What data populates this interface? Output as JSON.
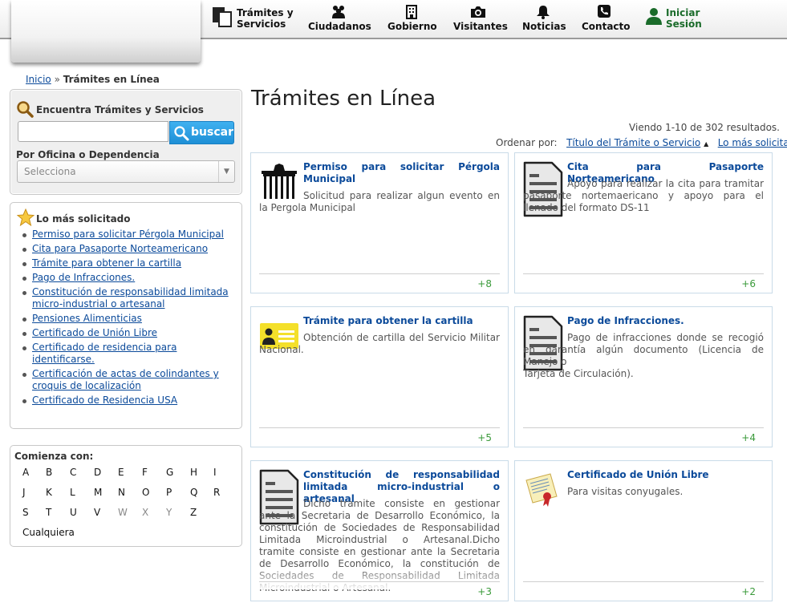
{
  "nav": {
    "items": [
      {
        "label_1": "Trámites y",
        "label_2": "Servicios"
      },
      {
        "label": "Ciudadanos"
      },
      {
        "label": "Gobierno"
      },
      {
        "label": "Visitantes"
      },
      {
        "label": "Noticias"
      },
      {
        "label": "Contacto"
      },
      {
        "label_1": "Iniciar",
        "label_2": "Sesión"
      }
    ]
  },
  "breadcrumb": {
    "home": "Inicio",
    "sep": "»",
    "current": "Trámites en Línea"
  },
  "search": {
    "title": "Encuentra Trámites y Servicios",
    "input_value": "",
    "button": "buscar",
    "office_label": "Por Oficina o Dependencia",
    "office_selected": "Selecciona"
  },
  "popular": {
    "title": "Lo más solicitado",
    "items": [
      "Permiso para solicitar Pérgola Municipal",
      "Cita para Pasaporte Norteamericano",
      "Trámite para obtener la cartilla",
      "Pago de Infracciones.",
      "Constitución de responsabilidad limitada micro-industrial o artesanal",
      "Pensiones Alimenticias",
      "Certificado de Unión Libre",
      "Certificado de residencia para identificarse.",
      "Certificación de actas de colindantes y croquis de localización",
      "Certificado de Residencia USA"
    ]
  },
  "alpha": {
    "title": "Comienza con:",
    "letters": [
      "A",
      "B",
      "C",
      "D",
      "E",
      "F",
      "G",
      "H",
      "I",
      "J",
      "K",
      "L",
      "M",
      "N",
      "O",
      "P",
      "Q",
      "R",
      "S",
      "T",
      "U",
      "V",
      "W",
      "X",
      "Y",
      "Z"
    ],
    "disabled": [
      "W",
      "X",
      "Y"
    ],
    "any": "Cualquiera"
  },
  "main": {
    "title": "Trámites en Línea",
    "results": "Viendo 1-10 de 302 resultados.",
    "order_label": "Ordenar por:",
    "order_title": "Título del Trámite o Servicio",
    "order_popular": "Lo más solicitado"
  },
  "cards": [
    {
      "icon": "pergola-gate-icon",
      "title": "Permiso para solicitar Pérgola Municipal",
      "desc": "Solicitud para realizar algun evento en la Pergola Municipal",
      "count": "+8"
    },
    {
      "icon": "document-icon",
      "title": "Cita para Pasaporte Norteamericano",
      "desc": "Apoyo para realizar la cita para tramitar pasaporte nortemaericano y apoyo para el llenado del formato DS-11",
      "count": "+6"
    },
    {
      "icon": "id-card-icon",
      "title": "Trámite para obtener la cartilla",
      "desc": "Obtención de cartilla del Servicio Militar Nacional.",
      "count": "+5"
    },
    {
      "icon": "document-icon",
      "title": "Pago de Infracciones.",
      "desc": "Pago de infracciones donde se recogió en garantía algún documento (Licencia de Manejo o\nTarjeta de Circulación).",
      "count": "+4"
    },
    {
      "icon": "document-icon",
      "title": "Constitución de responsabilidad limitada micro-industrial o artesanal",
      "desc": "Dicho tramite consiste en gestionar ante la Secretaria de Desarrollo Económico, la constitución de Sociedades de Responsabilidad Limitada Microindustrial o Artesanal.Dicho tramite consiste en gestionar ante la Secretaria de Desarrollo Económico, la constitución de Sociedades de Responsabilidad Limitada Microindustrial o Artesanal.",
      "count": "+3"
    },
    {
      "icon": "certificate-icon",
      "title": "Certificado de Unión Libre",
      "desc": "Para visitas conyugales.",
      "count": "+2"
    }
  ]
}
